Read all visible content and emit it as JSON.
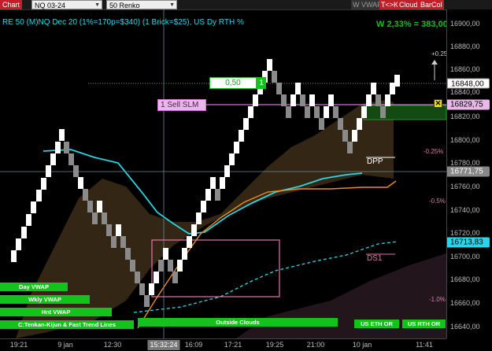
{
  "toolbar": {
    "chart_tab": "Chart",
    "instrument": "NQ 03-24",
    "bar_type": "50 Renko",
    "toggles": [
      {
        "label": "W VWAP",
        "color": "#9a9a9a",
        "bg": "#333333"
      },
      {
        "label": "T<>K",
        "color": "#ffffff",
        "bg": "#c0202a"
      },
      {
        "label": "Cloud",
        "color": "#ffffff",
        "bg": "#c0202a"
      },
      {
        "label": "BarCol",
        "color": "#ffffff",
        "bg": "#c0202a"
      }
    ]
  },
  "chart_header": "RE 50 (M)NQ Dec 20 (1%=170p=$340) (1 Brick=$25), US Dy RTH %",
  "pnl_readout": "W 2,33% = 383,00",
  "order": {
    "quantity": "0,50",
    "count": "1",
    "sell_label": "1  Sell SLM"
  },
  "close_icon_glyph": "✕",
  "percent_labels": [
    "+0.25",
    "-0.25%",
    "-0.5%",
    "-1.0%"
  ],
  "level_labels": {
    "dpp": "DPP",
    "ds1": "DS1"
  },
  "price_axis": {
    "ticks": [
      "16900,00",
      "16880,00",
      "16860,00",
      "16840,00",
      "16820,00",
      "16800,00",
      "16780,00",
      "16760,00",
      "16740,00",
      "16720,00",
      "16700,00",
      "16680,00",
      "16660,00",
      "16640,00"
    ],
    "badges": {
      "last": "16848,00",
      "order": "16829,75",
      "crosshair": "16771,75",
      "vwap": "16713,83"
    }
  },
  "time_axis": {
    "ticks": [
      "19:21",
      "9 jan",
      "12:30",
      "16:09",
      "17:21",
      "19:25",
      "21:00",
      "10 jan",
      "11:41"
    ],
    "crosshair_time": "15:32:24"
  },
  "legend_bars": {
    "day_vwap": "Day VWAP",
    "wkly_vwap": "Wkly VWAP",
    "hnt_vwap": "Hnt VWAP",
    "tenkan": "C:Tenkan-Kijun & Fast Trend Lines",
    "outside_clouds": "Outside Clouds",
    "us_eth_or": "US ETH OR",
    "us_rth_or": "US RTH OR"
  },
  "colors": {
    "up_brick": "#ffffff",
    "down_brick": "#8a8a8a",
    "vwap_line": "#2ad6e6",
    "trend_line": "#f08c1a",
    "cloud": "#3a2a16",
    "order_line": "#d070d0",
    "green_label": "#13c31b"
  }
}
